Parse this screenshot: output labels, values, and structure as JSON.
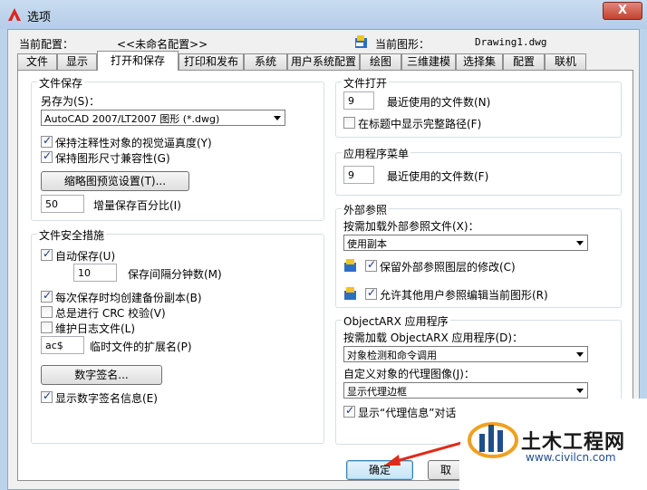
{
  "window": {
    "title": "选项",
    "close_label": "X"
  },
  "header": {
    "profile_label": "当前配置：",
    "profile_value": "<<未命名配置>>",
    "drawing_label": "当前图形：",
    "drawing_value": "Drawing1.dwg"
  },
  "tabs": [
    {
      "label": "文件"
    },
    {
      "label": "显示"
    },
    {
      "label": "打开和保存"
    },
    {
      "label": "打印和发布"
    },
    {
      "label": "系统"
    },
    {
      "label": "用户系统配置"
    },
    {
      "label": "绘图"
    },
    {
      "label": "三维建模"
    },
    {
      "label": "选择集"
    },
    {
      "label": "配置"
    },
    {
      "label": "联机"
    }
  ],
  "file_save": {
    "title": "文件保存",
    "save_as_label": "另存为(S)：",
    "save_as_value": "AutoCAD 2007/LT2007 图形 (*.dwg)",
    "annotative_label": "保持注释性对象的视觉逼真度(Y)",
    "annotative_checked": true,
    "drawing_size_label": "保持图形尺寸兼容性(G)",
    "drawing_size_checked": true,
    "thumbnail_button": "缩略图预览设置(T)...",
    "incremental_value": "50",
    "incremental_label": "增量保存百分比(I)"
  },
  "file_safety": {
    "title": "文件安全措施",
    "autosave_label": "自动保存(U)",
    "autosave_checked": true,
    "interval_value": "10",
    "interval_label": "保存间隔分钟数(M)",
    "backup_label": "每次保存时均创建备份副本(B)",
    "backup_checked": true,
    "crc_label": "总是进行 CRC 校验(V)",
    "crc_checked": false,
    "log_label": "维护日志文件(L)",
    "log_checked": false,
    "temp_ext_value": "ac$",
    "temp_ext_label": "临时文件的扩展名(P)",
    "digital_sig_button": "数字签名...",
    "show_sig_label": "显示数字签名信息(E)",
    "show_sig_checked": true
  },
  "file_open": {
    "title": "文件打开",
    "recent_value": "9",
    "recent_label": "最近使用的文件数(N)",
    "fullpath_label": "在标题中显示完整路径(F)",
    "fullpath_checked": false
  },
  "app_menu": {
    "title": "应用程序菜单",
    "recent_value": "9",
    "recent_label": "最近使用的文件数(F)"
  },
  "xref": {
    "title": "外部参照",
    "demand_load_label": "按需加载外部参照文件(X)：",
    "demand_load_value": "使用副本",
    "retain_label": "保留外部参照图层的修改(C)",
    "retain_checked": true,
    "allow_edit_label": "允许其他用户参照编辑当前图形(R)",
    "allow_edit_checked": true
  },
  "objectarx": {
    "title": "ObjectARX 应用程序",
    "demand_load_label": "按需加载 ObjectARX 应用程序(D)：",
    "demand_load_value": "对象检测和命令调用",
    "proxy_label": "自定义对象的代理图像(J)：",
    "proxy_value": "显示代理边框",
    "show_proxy_label": "显示“代理信息”对话",
    "show_proxy_checked": true
  },
  "footer": {
    "ok_label": "确定",
    "cancel_label": "取"
  },
  "watermark": {
    "title": "土木工程网",
    "url": "www.civilcn.com"
  },
  "colors": {
    "accent_red": "#e02a1a",
    "title_bg": "#bcd3ec",
    "tab_active": "#ffffff"
  }
}
